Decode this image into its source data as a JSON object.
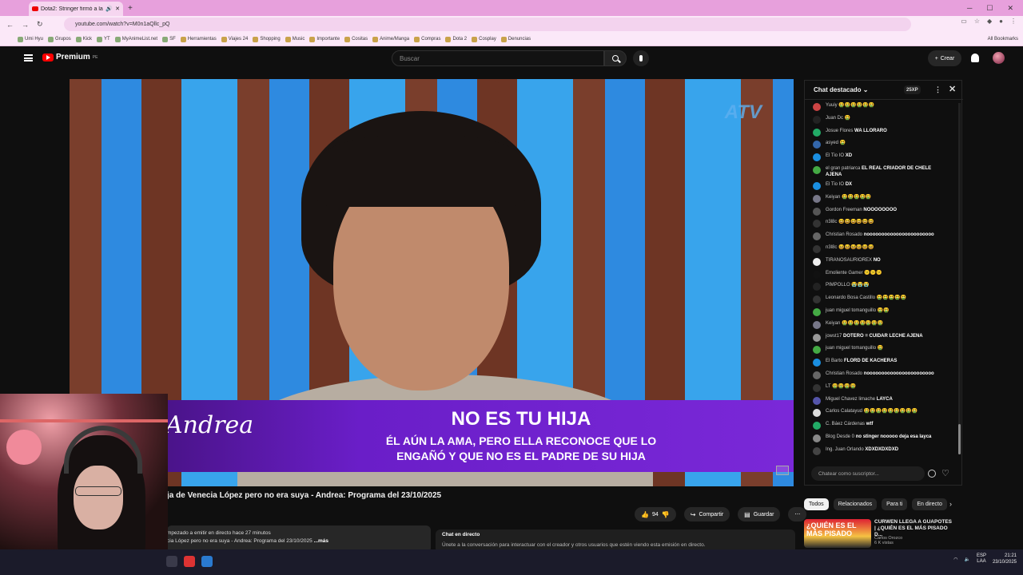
{
  "browser": {
    "tab_title": "Dota2: Stringer firmó a la h",
    "url": "youtube.com/watch?v=M0n1aQllc_pQ",
    "bookmarks": [
      "Umi Hyu",
      "Grupos",
      "Kick",
      "YT",
      "MyAnimeList.net",
      "SF",
      "Herramientas",
      "Viajes 24",
      "Shopping",
      "Music",
      "Importante",
      "Cositas",
      "Anime/Manga",
      "Compras",
      "Dota 2",
      "Cosplay",
      "Denuncias"
    ],
    "all_bookmarks": "All Bookmarks"
  },
  "header": {
    "logo": "Premium",
    "logo_region": "PE",
    "search_placeholder": "Buscar",
    "create_label": "Crear"
  },
  "video": {
    "lower_third_name": "Andrea",
    "headline": "NO ES TU HIJA",
    "subline_1": "ÉL AÚN LA AMA, PERO ELLA RECONOCE QUE LO",
    "subline_2": "ENGAÑÓ Y QUE NO ES EL PADRE DE SU HIJA",
    "title": "ja de Venecia López pero no era suya - Andrea: Programa del 23/10/2025",
    "likes": "94",
    "share_label": "Compartir",
    "save_label": "Guardar",
    "desc_line1": "mpezado a emitir en directo hace 27 minutos",
    "desc_line2": "cia López pero no era suya - Andrea: Programa del 23/10/2025",
    "desc_more": "...más",
    "live_chat_title": "Chat en directo",
    "live_chat_text": "Únete a la conversación para interactuar con el creador y otros usuarios que estén viendo esta emisión en directo."
  },
  "chat": {
    "title": "Chat destacado",
    "xp": "25XP",
    "input_placeholder": "Chatear como suscriptor...",
    "messages": [
      {
        "author": "Yuuiy",
        "text": "🤮🤮🤮🤮🤮🤮",
        "color": "#c44"
      },
      {
        "author": "Juan Dc",
        "text": "🤮",
        "color": "#222"
      },
      {
        "author": "Josue Flores",
        "text": "WA LLORARO",
        "color": "#2a6"
      },
      {
        "author": "asyed",
        "text": "🤮",
        "color": "#36a"
      },
      {
        "author": "El Tio IO",
        "text": "XD",
        "color": "#1a8ee0"
      },
      {
        "author": "el gran patriarca",
        "text": "EL REAL CRIADOR DE CHELE AJENA",
        "color": "#4a4"
      },
      {
        "author": "El Tio IO",
        "text": "DX",
        "color": "#1a8ee0"
      },
      {
        "author": "Keiyan",
        "text": "🤮🤮🤮🤮🤮",
        "color": "#778"
      },
      {
        "author": "Gordon Freeman",
        "text": "NOOOOOOOO",
        "color": "#555"
      },
      {
        "author": "n3l8c",
        "text": "😆😆😆😆😆😆",
        "color": "#333"
      },
      {
        "author": "Christian Rosado",
        "text": "nooooooooooooooooooooooo",
        "color": "#666"
      },
      {
        "author": "n3l8c",
        "text": "😆😆😆😆😆😆",
        "color": "#333"
      },
      {
        "author": "TIRANOSAURIOREX",
        "text": "NO",
        "color": "#eee"
      },
      {
        "author": "Emoliente Gamer",
        "text": "😕😕😕",
        "color": "#111"
      },
      {
        "author": "PIMPOLLO",
        "text": "😭😭😭",
        "color": "#222"
      },
      {
        "author": "Leonardo Bosa Castillo",
        "text": "🤮🤮🤮🤮🤮",
        "color": "#333"
      },
      {
        "author": "juan miguel tomanguillo",
        "text": "🤮🤮",
        "color": "#4a4"
      },
      {
        "author": "Keiyan",
        "text": "🤮🤮🤮🤮🤮🤮🤮",
        "color": "#778"
      },
      {
        "author": "jowst17",
        "text": "DOTERO = CUIDAR LECHE AJENA",
        "color": "#999"
      },
      {
        "author": "juan miguel tomanguillo",
        "text": "🤮",
        "color": "#4a4"
      },
      {
        "author": "El Barto",
        "text": "FLORD DE KACHERAS",
        "color": "#1a8ee0"
      },
      {
        "author": "Christian Rosado",
        "text": "nooooooooooooooooooooooo",
        "color": "#666"
      },
      {
        "author": "LT",
        "text": "🤮🤮🤮🤮",
        "color": "#333"
      },
      {
        "author": "Miguel Chavez limache",
        "text": "LAYCA",
        "color": "#55a"
      },
      {
        "author": "Carlos Calatayud",
        "text": "🤮🤮🤮🤮🤮🤮🤮🤮🤮",
        "color": "#ddd"
      },
      {
        "author": "C. Báez Cárdenas",
        "text": "wtf",
        "color": "#2a6"
      },
      {
        "author": "Blog Desde 0",
        "text": "no stinger nooooo deja esa layca",
        "color": "#888"
      },
      {
        "author": "Ing. Juan Orlando",
        "text": "XDXDXDXDXD",
        "color": "#444"
      }
    ]
  },
  "chips": [
    "Todos",
    "Relacionados",
    "Para ti",
    "En directo"
  ],
  "recommendation": {
    "thumb_text": "¿QUIÉN ES EL MÁS PISADO",
    "title": "CURWEN LLEGA A GUAPOTES | ¿QUIÉN ES EL MÁS PISADO D...",
    "channel": "Carlos Orozco",
    "meta": "6 K vistas"
  },
  "taskbar": {
    "lang_1": "ESP",
    "lang_2": "LAA",
    "time": "21:21",
    "date": "23/10/2025"
  }
}
